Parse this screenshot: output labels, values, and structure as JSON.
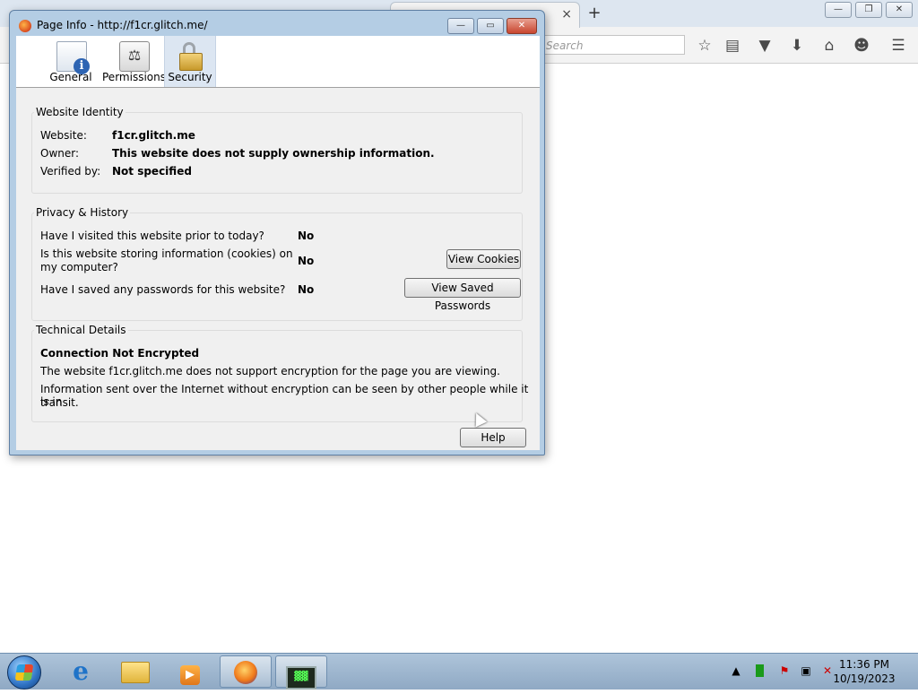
{
  "browser": {
    "tab_close": "×",
    "new_tab": "+",
    "search_placeholder": "Search",
    "window_controls": {
      "minimize": "—",
      "restore": "❐",
      "close": "✕"
    },
    "toolbar_icons": [
      "star-icon",
      "reading-list-icon",
      "pocket-icon",
      "download-icon",
      "home-icon",
      "chat-icon",
      "menu-icon"
    ]
  },
  "dialog": {
    "title": "Page Info - http://f1cr.glitch.me/",
    "controls": {
      "minimize": "—",
      "restore": "▭",
      "close": "✕"
    },
    "tabs": [
      {
        "label": "General",
        "icon": "info-icon"
      },
      {
        "label": "Permissions",
        "icon": "permissions-icon"
      },
      {
        "label": "Security",
        "icon": "lock-icon",
        "selected": true
      }
    ],
    "identity": {
      "legend": "Website Identity",
      "website_label": "Website:",
      "website_value": "f1cr.glitch.me",
      "owner_label": "Owner:",
      "owner_value": "This website does not supply ownership information.",
      "verified_label": "Verified by:",
      "verified_value": "Not specified"
    },
    "privacy": {
      "legend": "Privacy & History",
      "visited_q": "Have I visited this website prior to today?",
      "visited_a": "No",
      "cookies_q_line1": "Is this website storing information (cookies) on",
      "cookies_q_line2": "my computer?",
      "cookies_a": "No",
      "view_cookies": "View Cookies",
      "passwords_q": "Have I saved any passwords for this website?",
      "passwords_a": "No",
      "view_passwords": "View Saved Passwords"
    },
    "technical": {
      "legend": "Technical Details",
      "heading": "Connection Not Encrypted",
      "line1": "The website f1cr.glitch.me does not support encryption for the page you are viewing.",
      "line2a": "Information sent over the Internet without encryption can be seen by other people while it is in",
      "line2b": "transit."
    },
    "help_button": "Help"
  },
  "taskbar": {
    "apps": [
      "internet-explorer",
      "file-explorer",
      "media-player",
      "firefox",
      "terminal"
    ],
    "clock_time": "11:36 PM",
    "clock_date": "10/19/2023"
  }
}
